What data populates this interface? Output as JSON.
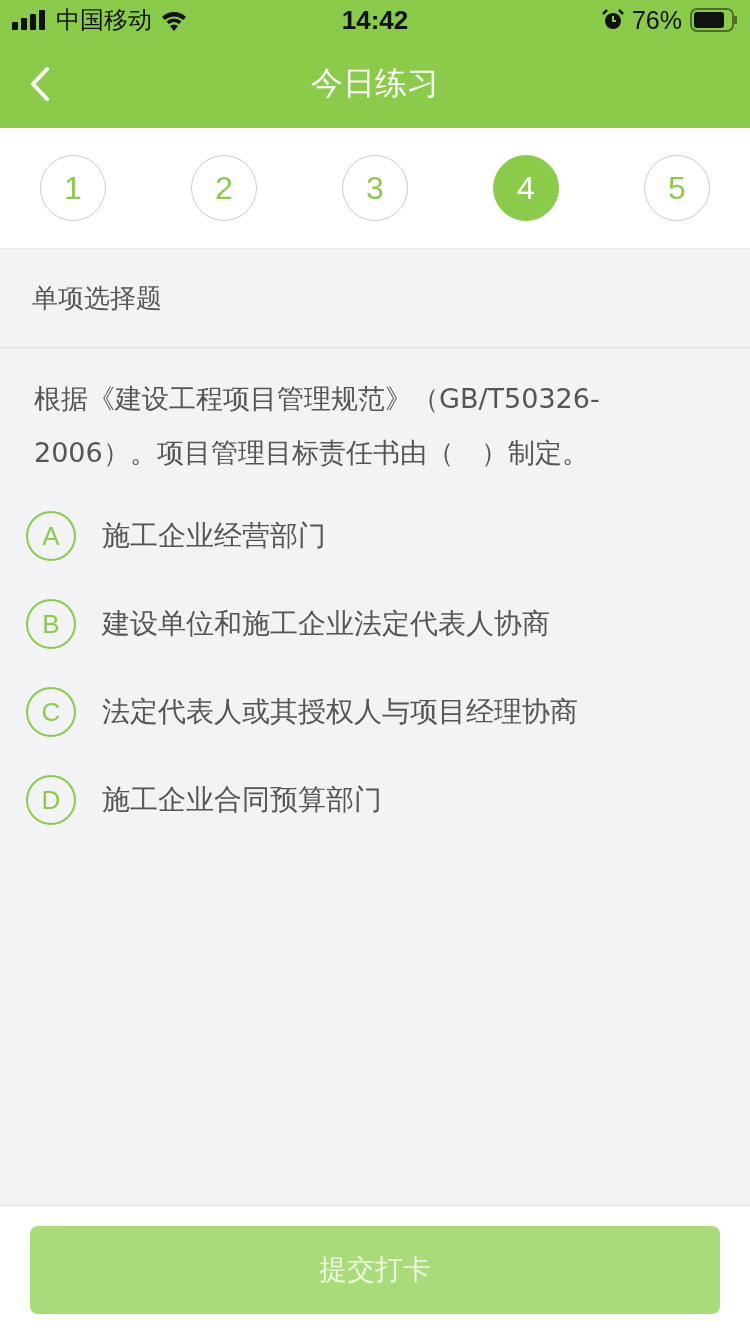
{
  "status_bar": {
    "carrier": "中国移动",
    "time": "14:42",
    "battery": "76%"
  },
  "nav": {
    "title": "今日练习"
  },
  "questions": [
    {
      "number": "1",
      "selected": false
    },
    {
      "number": "2",
      "selected": false
    },
    {
      "number": "3",
      "selected": false
    },
    {
      "number": "4",
      "selected": true
    },
    {
      "number": "5",
      "selected": false
    }
  ],
  "question_type": "单项选择题",
  "question": "根据《建设工程项目管理规范》（GB/T50326-2006）。项目管理目标责任书由（　）制定。",
  "options": [
    {
      "letter": "A",
      "text": "施工企业经营部门",
      "selected": false
    },
    {
      "letter": "B",
      "text": "建设单位和施工企业法定代表人协商",
      "selected": false
    },
    {
      "letter": "C",
      "text": "法定代表人或其授权人与项目经理协商",
      "selected": false
    },
    {
      "letter": "D",
      "text": "施工企业合同预算部门",
      "selected": false
    }
  ],
  "submit": {
    "label": "提交打卡",
    "disabled": true
  }
}
